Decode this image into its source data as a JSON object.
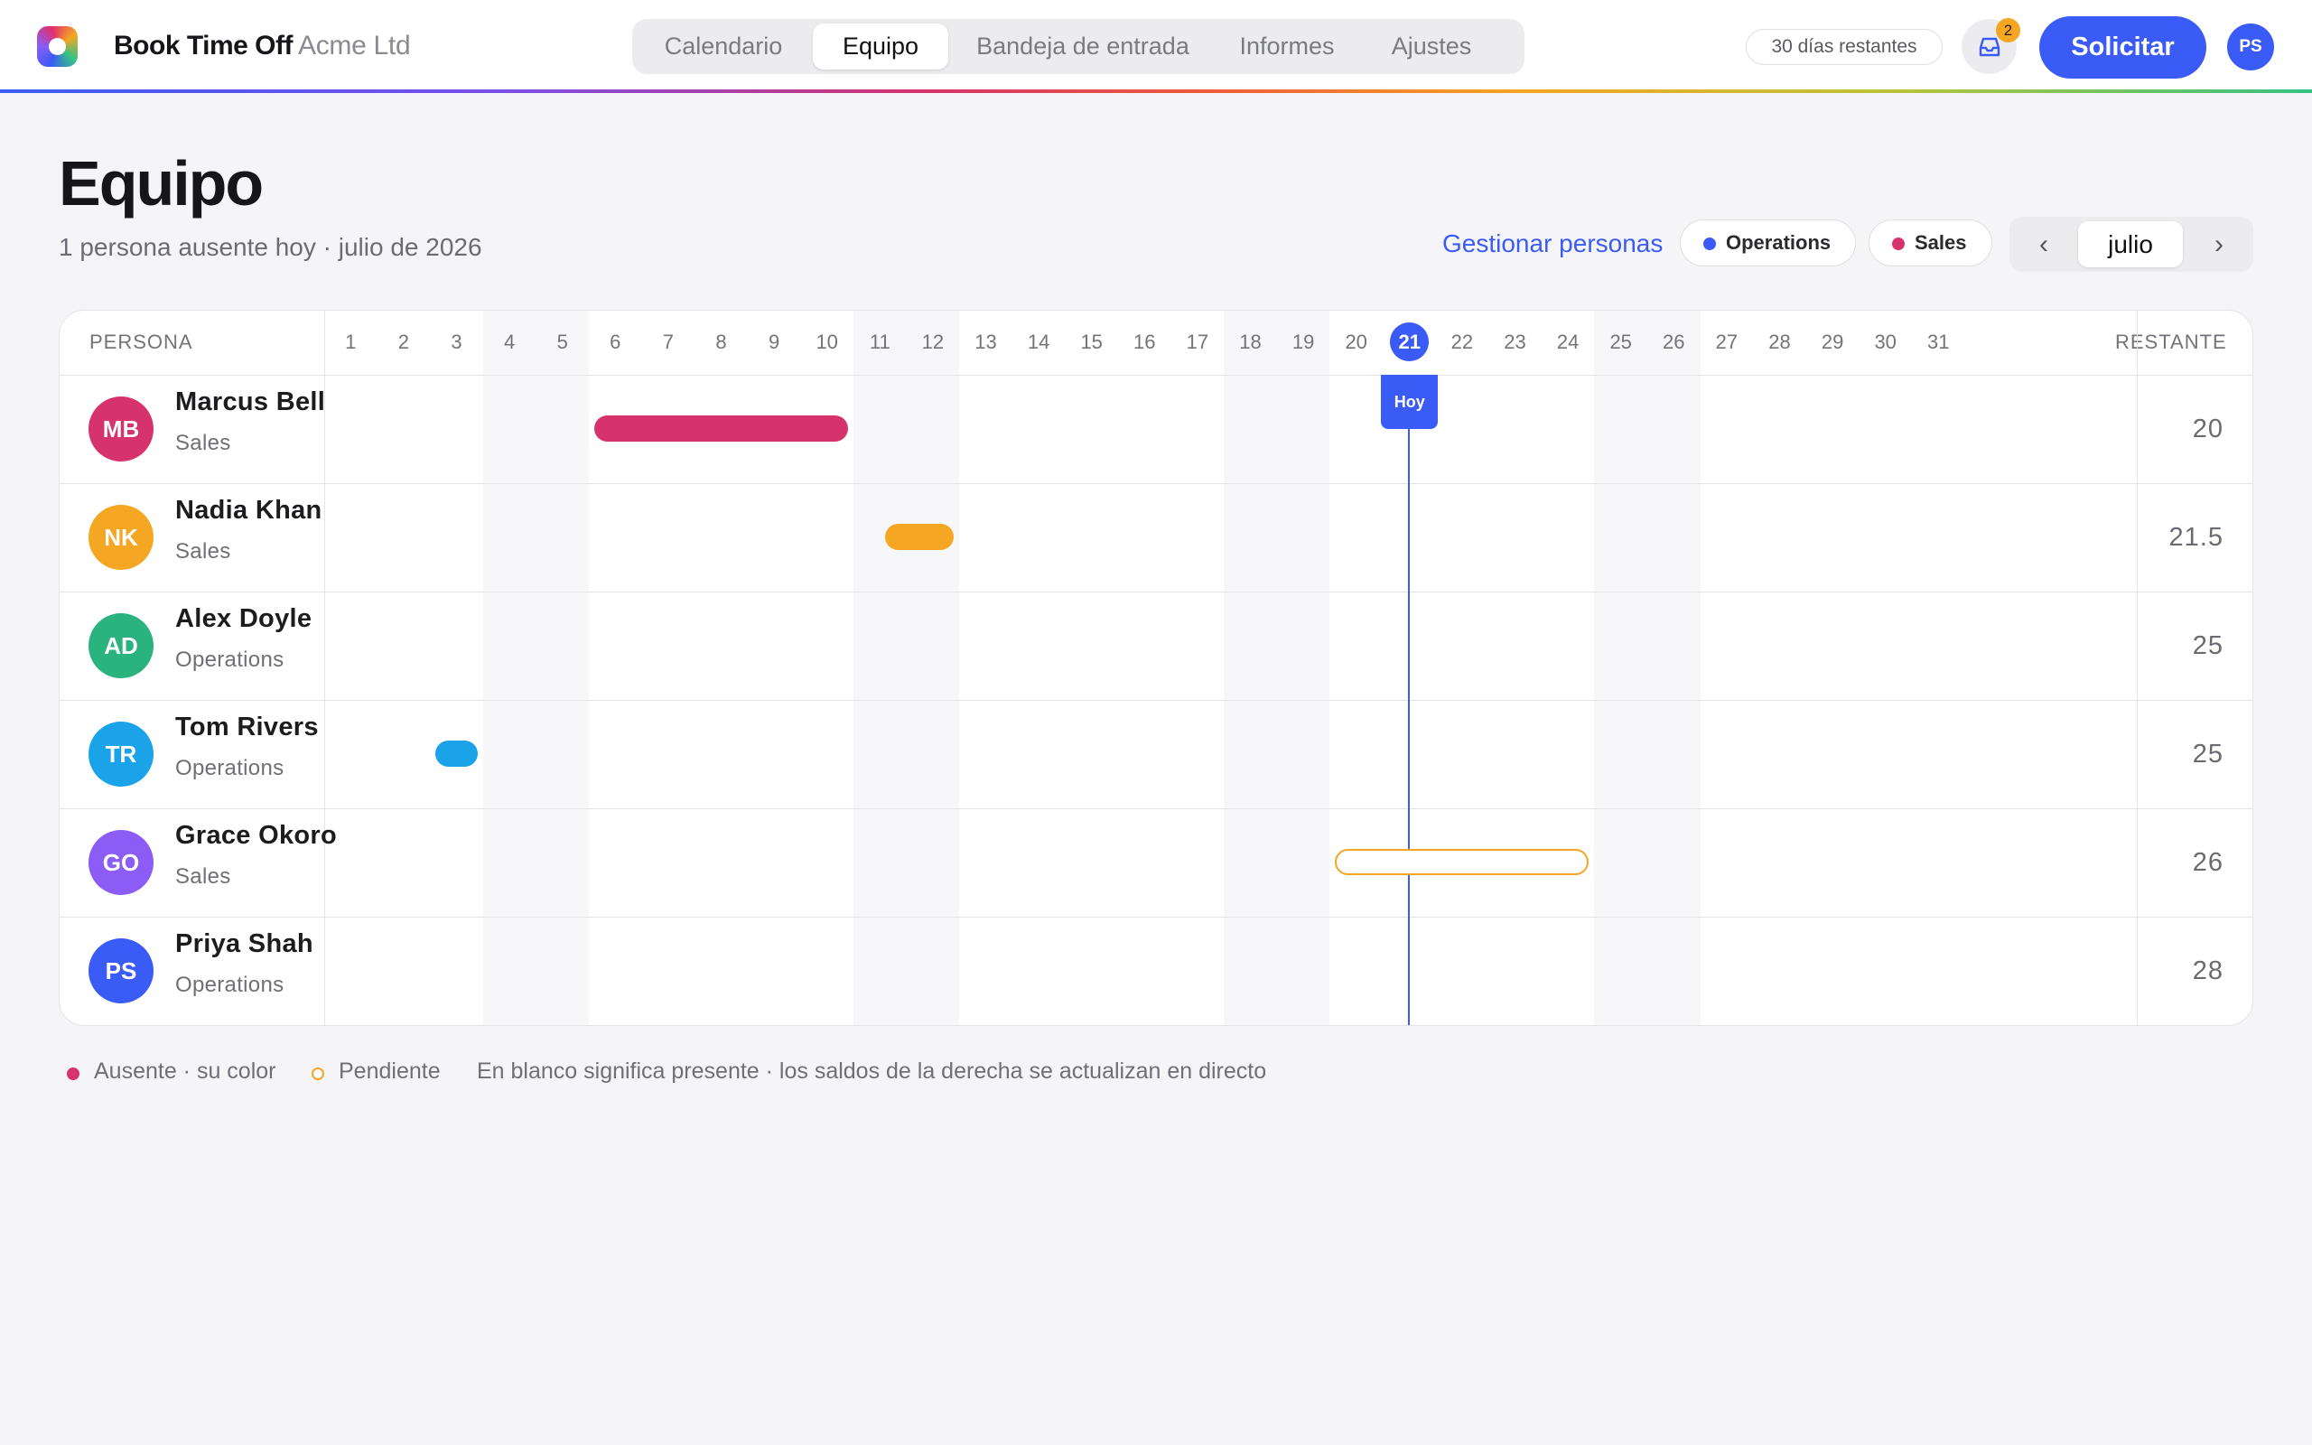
{
  "app": {
    "brand": "Book Time Off",
    "company": "Acme Ltd"
  },
  "nav": {
    "tabs": [
      {
        "label": "Calendario",
        "active": false
      },
      {
        "label": "Equipo",
        "active": true
      },
      {
        "label": "Bandeja de entrada",
        "active": false
      },
      {
        "label": "Informes",
        "active": false
      },
      {
        "label": "Ajustes",
        "active": false
      }
    ]
  },
  "topbar": {
    "days_left": "30 días restantes",
    "inbox_icon": "inbox-icon",
    "inbox_badge": "2",
    "request_label": "Solicitar",
    "user_initials": "PS"
  },
  "header": {
    "title": "Equipo",
    "subtitle": "1 persona ausente hoy · julio de 2026",
    "manage_link": "Gestionar personas",
    "filters": [
      {
        "label": "Operations",
        "color": "#3b5bf6"
      },
      {
        "label": "Sales",
        "color": "#d6336c"
      }
    ],
    "month": {
      "prev": "‹",
      "label": "julio",
      "next": "›"
    }
  },
  "grid": {
    "person_header": "PERSONA",
    "remaining_header": "RESTANTE",
    "days": [
      "1",
      "2",
      "3",
      "4",
      "5",
      "6",
      "7",
      "8",
      "9",
      "10",
      "11",
      "12",
      "13",
      "14",
      "15",
      "16",
      "17",
      "18",
      "19",
      "20",
      "21",
      "22",
      "23",
      "24",
      "25",
      "26",
      "27",
      "28",
      "29",
      "30",
      "31"
    ],
    "weekend_days": [
      4,
      5,
      11,
      12,
      18,
      19,
      25,
      26
    ],
    "today": 21,
    "today_label": "Hoy",
    "people": [
      {
        "initials": "MB",
        "name": "Marcus Bell",
        "team": "Sales",
        "avatar_color": "#d6336c",
        "remaining": "20",
        "absences": [
          {
            "start": 6,
            "end": 10,
            "color": "#d6336c",
            "pending": false
          }
        ]
      },
      {
        "initials": "NK",
        "name": "Nadia Khan",
        "team": "Sales",
        "avatar_color": "#f5a623",
        "remaining": "21.5",
        "absences": [
          {
            "start": 11.5,
            "end": 12,
            "color": "#f5a623",
            "pending": false
          }
        ]
      },
      {
        "initials": "AD",
        "name": "Alex Doyle",
        "team": "Operations",
        "avatar_color": "#2bb37f",
        "remaining": "25",
        "absences": []
      },
      {
        "initials": "TR",
        "name": "Tom Rivers",
        "team": "Operations",
        "avatar_color": "#1aa3e8",
        "remaining": "25",
        "absences": [
          {
            "start": 3,
            "end": 3,
            "color": "#1aa3e8",
            "pending": false
          }
        ]
      },
      {
        "initials": "GO",
        "name": "Grace Okoro",
        "team": "Sales",
        "avatar_color": "#8b5cf6",
        "remaining": "26",
        "absences": [
          {
            "start": 20,
            "end": 24,
            "color": "#f5a623",
            "pending": true
          }
        ]
      },
      {
        "initials": "PS",
        "name": "Priya Shah",
        "team": "Operations",
        "avatar_color": "#3b5bf6",
        "remaining": "28",
        "absences": []
      }
    ]
  },
  "legend": {
    "absent": "Ausente · su color",
    "absent_color": "#d6336c",
    "pending": "Pendiente",
    "pending_color": "#f5a623",
    "note": "En blanco significa presente · los saldos de la derecha se actualizan en directo"
  }
}
